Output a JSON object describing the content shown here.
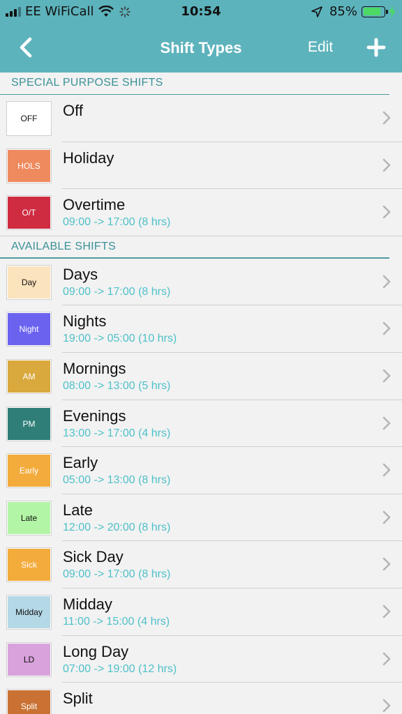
{
  "status_bar": {
    "carrier": "EE WiFiCall",
    "time": "10:54",
    "battery_percent": "85%",
    "battery_level": 0.85,
    "icons": [
      "signal-icon",
      "wifi-icon",
      "spinner-icon",
      "location-arrow-icon",
      "battery-icon",
      "charging-bolt-icon"
    ]
  },
  "nav": {
    "title": "Shift Types",
    "edit_label": "Edit",
    "back_icon": "chevron-left-icon",
    "add_icon": "plus-icon"
  },
  "colors": {
    "accent": "#5db3bc",
    "section_text": "#3a9097",
    "time_text": "#4ec0c9"
  },
  "sections": [
    {
      "header": "SPECIAL PURPOSE SHIFTS",
      "items": [
        {
          "badge": "OFF",
          "badge_bg": "#ffffff",
          "badge_fg": "#111111",
          "title": "Off",
          "time": ""
        },
        {
          "badge": "HOLS",
          "badge_bg": "#ef8a5f",
          "badge_fg": "#ffffff",
          "title": "Holiday",
          "time": ""
        },
        {
          "badge": "O/T",
          "badge_bg": "#cf2c42",
          "badge_fg": "#ffffff",
          "title": "Overtime",
          "time": "09:00 -> 17:00 (8 hrs)"
        }
      ]
    },
    {
      "header": "AVAILABLE SHIFTS",
      "items": [
        {
          "badge": "Day",
          "badge_bg": "#fbe3bd",
          "badge_fg": "#111111",
          "title": "Days",
          "time": "09:00 -> 17:00 (8 hrs)"
        },
        {
          "badge": "Night",
          "badge_bg": "#6b63f0",
          "badge_fg": "#ffffff",
          "title": "Nights",
          "time": "19:00 -> 05:00 (10 hrs)"
        },
        {
          "badge": "AM",
          "badge_bg": "#d9a93e",
          "badge_fg": "#ffffff",
          "title": "Mornings",
          "time": "08:00 -> 13:00 (5 hrs)"
        },
        {
          "badge": "PM",
          "badge_bg": "#2f7e78",
          "badge_fg": "#ffffff",
          "title": "Evenings",
          "time": "13:00 -> 17:00 (4 hrs)"
        },
        {
          "badge": "Early",
          "badge_bg": "#f3ab3c",
          "badge_fg": "#ffffff",
          "title": "Early",
          "time": "05:00 -> 13:00 (8 hrs)"
        },
        {
          "badge": "Late",
          "badge_bg": "#b3f5a6",
          "badge_fg": "#111111",
          "title": "Late",
          "time": "12:00 -> 20:00 (8 hrs)"
        },
        {
          "badge": "Sick",
          "badge_bg": "#f3ab3c",
          "badge_fg": "#ffffff",
          "title": "Sick Day",
          "time": "09:00 -> 17:00 (8 hrs)"
        },
        {
          "badge": "Midday",
          "badge_bg": "#b5d8e6",
          "badge_fg": "#111111",
          "title": "Midday",
          "time": "11:00 -> 15:00 (4 hrs)"
        },
        {
          "badge": "LD",
          "badge_bg": "#d8a2dc",
          "badge_fg": "#111111",
          "title": "Long Day",
          "time": "07:00 -> 19:00 (12 hrs)"
        },
        {
          "badge": "Split",
          "badge_bg": "#c97233",
          "badge_fg": "#ffffff",
          "title": "Split",
          "time": ""
        }
      ]
    }
  ]
}
